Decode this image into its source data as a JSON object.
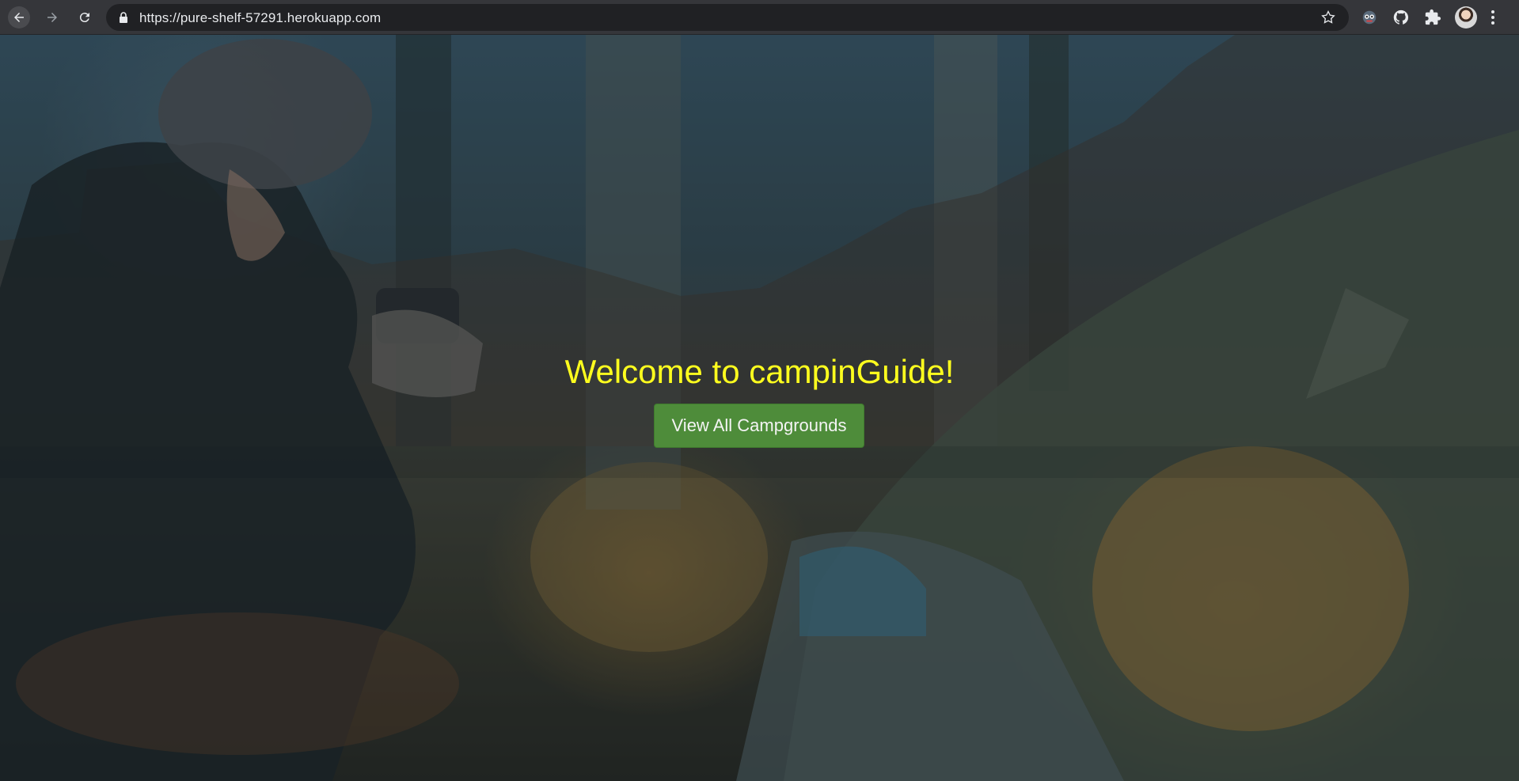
{
  "browser": {
    "url": "https://pure-shelf-57291.herokuapp.com",
    "icons": [
      "back-icon",
      "forward-icon",
      "reload-icon",
      "lock-icon",
      "star-icon",
      "extension-icon",
      "github-icon",
      "puzzle-icon",
      "avatar",
      "menu-icon"
    ]
  },
  "hero": {
    "heading": "Welcome to campinGuide!",
    "button_label": "View All Campgrounds"
  },
  "colors": {
    "heading": "#ffff1e",
    "button": "#4e8c3a",
    "browser_bar": "#35363a",
    "omnibox": "#202124"
  }
}
